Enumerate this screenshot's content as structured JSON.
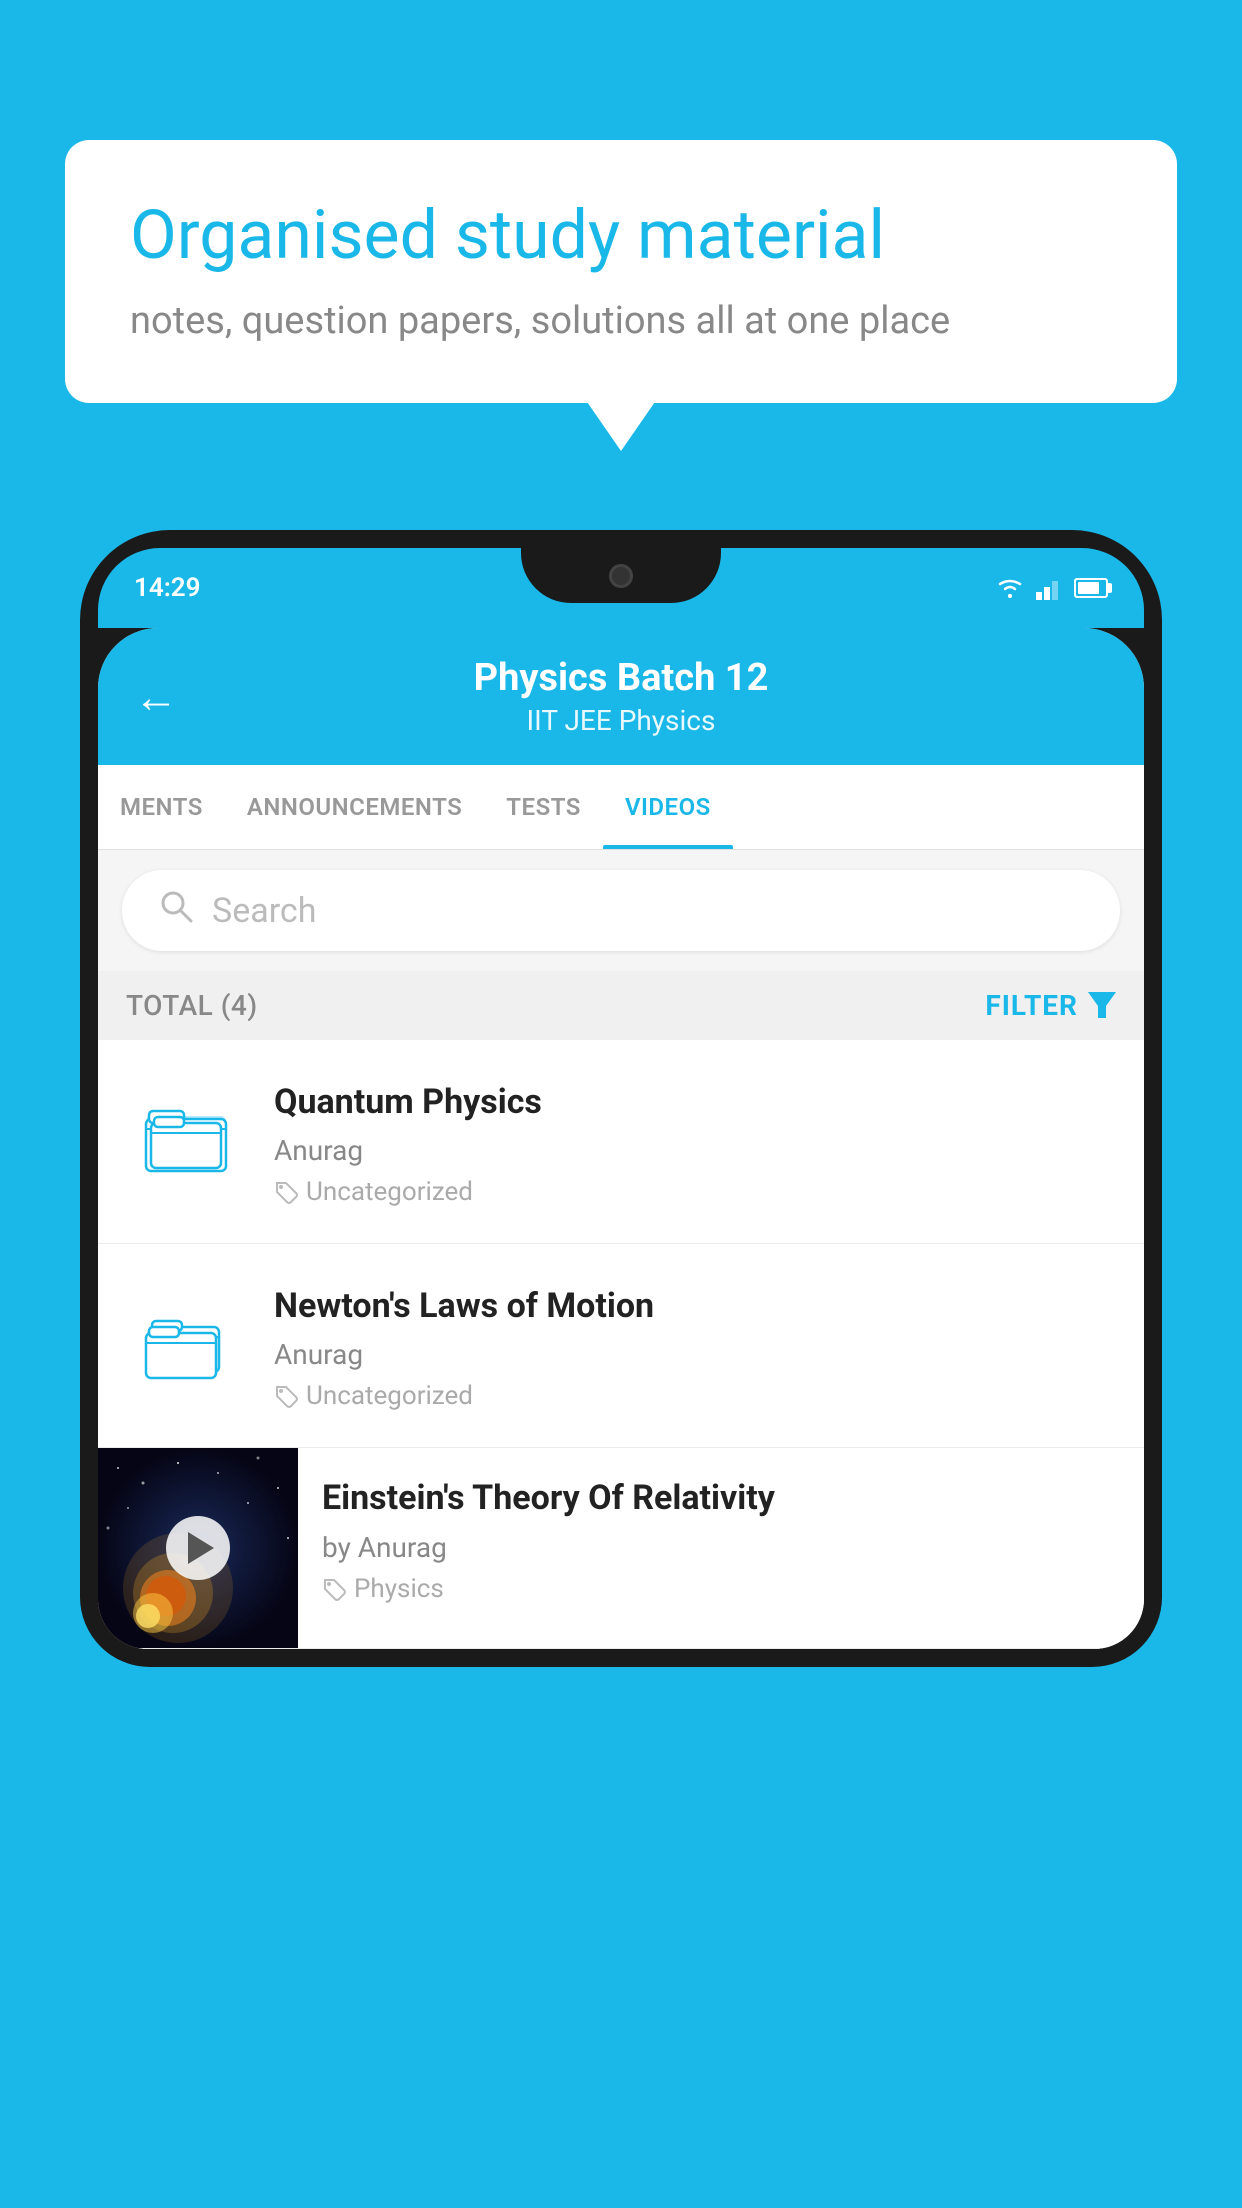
{
  "background_color": "#1ab8e8",
  "speech_bubble": {
    "title": "Organised study material",
    "subtitle": "notes, question papers, solutions all at one place"
  },
  "phone": {
    "status_bar": {
      "time": "14:29"
    },
    "header": {
      "title": "Physics Batch 12",
      "subtitle": "IIT JEE   Physics",
      "back_label": "←"
    },
    "tabs": [
      {
        "label": "MENTS",
        "active": false
      },
      {
        "label": "ANNOUNCEMENTS",
        "active": false
      },
      {
        "label": "TESTS",
        "active": false
      },
      {
        "label": "VIDEOS",
        "active": true
      }
    ],
    "search": {
      "placeholder": "Search"
    },
    "filter": {
      "total_label": "TOTAL (4)",
      "filter_label": "FILTER"
    },
    "videos": [
      {
        "id": 1,
        "title": "Quantum Physics",
        "author": "Anurag",
        "tag": "Uncategorized",
        "has_thumbnail": false
      },
      {
        "id": 2,
        "title": "Newton's Laws of Motion",
        "author": "Anurag",
        "tag": "Uncategorized",
        "has_thumbnail": false
      },
      {
        "id": 3,
        "title": "Einstein's Theory Of Relativity",
        "author": "by Anurag",
        "tag": "Physics",
        "has_thumbnail": true
      }
    ]
  }
}
